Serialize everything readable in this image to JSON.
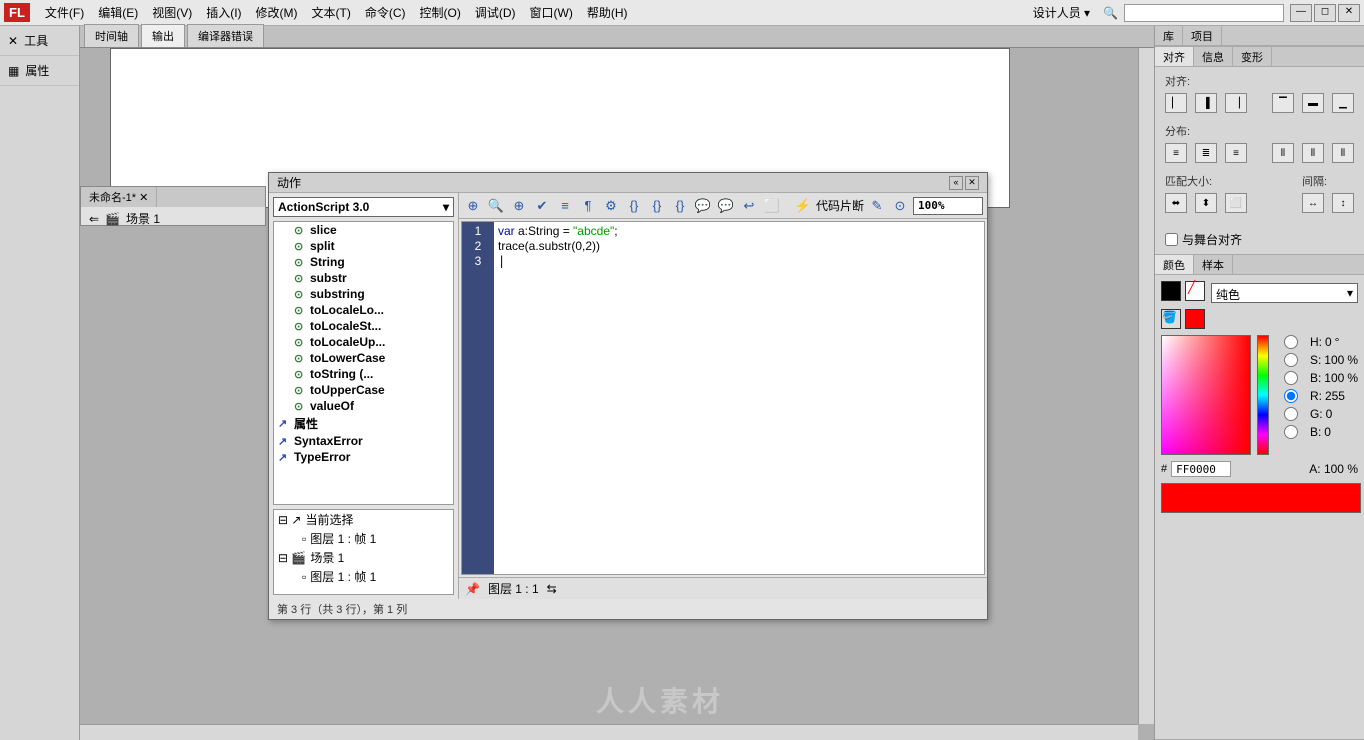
{
  "app": {
    "logo": "FL"
  },
  "menu": {
    "items": [
      "文件(F)",
      "编辑(E)",
      "视图(V)",
      "插入(I)",
      "修改(M)",
      "文本(T)",
      "命令(C)",
      "控制(O)",
      "调试(D)",
      "窗口(W)",
      "帮助(H)"
    ],
    "workspace": "设计人员 ▾"
  },
  "left_tools": {
    "tool": "工具",
    "props": "属性"
  },
  "doc_tabs": [
    "时间轴",
    "输出",
    "编译器错误"
  ],
  "nav": {
    "tab": "未命名-1* ✕",
    "scene": "场景 1"
  },
  "actions": {
    "title": "动作",
    "dropdown": "ActionScript 3.0",
    "methods": [
      "slice",
      "split",
      "String",
      "substr",
      "substring",
      "toLocaleLo...",
      "toLocaleSt...",
      "toLocaleUp...",
      "toLowerCase",
      "toString (...",
      "toUpperCase",
      "valueOf"
    ],
    "methods_top": [
      "属性",
      "SyntaxError",
      "TypeError"
    ],
    "tree": {
      "current_sel": "当前选择",
      "layer1": "图层 1 : 帧 1",
      "scene1": "场景 1",
      "layer2": "图层 1 : 帧 1"
    },
    "snippet_label": "代码片断",
    "zoom": "100%",
    "code": {
      "line1_pre": "var",
      "line1_mid": " a:String = ",
      "line1_str": "\"abcde\"",
      "line1_end": ";",
      "line2": "trace(a.substr(0,2))"
    },
    "gutter": [
      "1",
      "2",
      "3"
    ],
    "footer_layer": "图层 1 : 1",
    "status": "第 3 行（共 3 行），第 1 列"
  },
  "right": {
    "lib_tabs": [
      "库",
      "项目"
    ],
    "align_tabs": [
      "对齐",
      "信息",
      "变形"
    ],
    "align": {
      "label_align": "对齐:",
      "label_dist": "分布:",
      "label_match": "匹配大小:",
      "label_gap": "间隔:",
      "stage_check": "与舞台对齐"
    },
    "color_tabs": [
      "颜色",
      "样本"
    ],
    "color": {
      "type": "纯色",
      "H": "0",
      "H_unit": "°",
      "S": "100",
      "S_unit": "%",
      "B": "100",
      "B_unit": "%",
      "R": "255",
      "G": "0",
      "Bv": "0",
      "hex": "FF0000",
      "A": "100",
      "A_unit": "%"
    }
  },
  "watermark": "人人素材"
}
